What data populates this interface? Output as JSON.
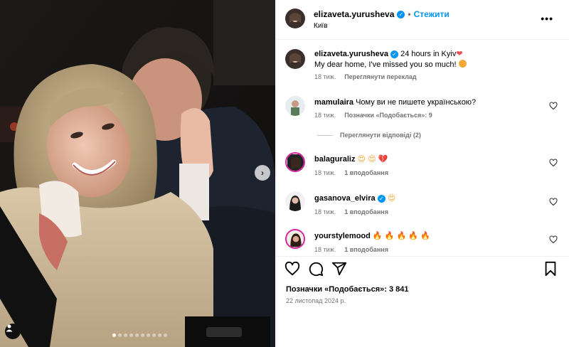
{
  "post": {
    "username": "elizaveta.yurusheva",
    "follow_label": "Стежити",
    "separator": "•",
    "location": "Київ",
    "more_label": "•••",
    "caption_text": "24 hours in Kyiv",
    "caption_line2": "My dear home, I've missed you so much!",
    "caption_time": "18 тиж.",
    "caption_translate": "Переглянути переклад",
    "carousel_next": "›",
    "slide_count": 10,
    "active_slide": 1
  },
  "comments": [
    {
      "user": "mamulaira",
      "text": "Чому ви не пишете українською?",
      "time": "18 тиж.",
      "likes": "Позначки «Подобається»: 9",
      "replies": "Переглянути відповіді (2)"
    },
    {
      "user": "balaguraliz",
      "text": "",
      "time": "18 тиж.",
      "likes": "1 вподобання"
    },
    {
      "user": "gasanova_elvira",
      "text": "",
      "time": "18 тиж.",
      "likes": "1 вподобання"
    },
    {
      "user": "yourstylemood",
      "text": "",
      "time": "18 тиж.",
      "likes": "1 вподобання"
    }
  ],
  "footer": {
    "likes_text": "Позначки «Подобається»: 3 841",
    "date_text": "22 листопад 2024 р."
  },
  "icons": {
    "like": "heart-icon",
    "comment": "comment-icon",
    "share": "share-icon",
    "save": "bookmark-icon",
    "verified": "verified-icon",
    "user_tags": "user-icon"
  },
  "colors": {
    "accent": "#0095f6",
    "meta": "#737373",
    "heart_red": "#ed4956",
    "story_ring": "#d6249f"
  }
}
